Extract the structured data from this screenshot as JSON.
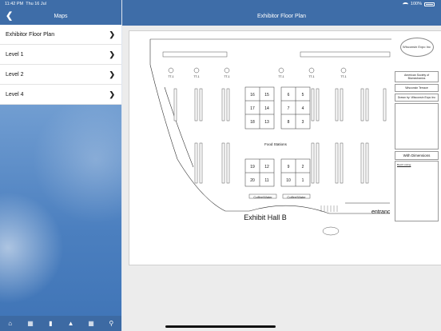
{
  "status_bar": {
    "time": "11:42 PM",
    "date": "Thu 16 Jul",
    "battery": "100%"
  },
  "sidebar": {
    "title": "Maps",
    "items": [
      {
        "label": "Exhibitor Floor Plan"
      },
      {
        "label": "Level 1"
      },
      {
        "label": "Level 2"
      },
      {
        "label": "Level 4"
      }
    ],
    "toolbar_icons": [
      "home-icon",
      "exhibitors-icon",
      "document-icon",
      "sitemap-icon",
      "grid-icon",
      "search-icon"
    ]
  },
  "main": {
    "title": "Exhibitor Floor Plan",
    "floorplan": {
      "hall_label": "Exhibit Hall B",
      "entrance_label": "entranc",
      "food_label": "Food Stations",
      "coffee_labels": [
        "Coffee/Water",
        "Coffee/Water"
      ],
      "tt_labels": [
        "TT-1",
        "TT-1",
        "TT-1",
        "TT-1",
        "TT-1",
        "TT-1"
      ],
      "booths_upper_left": [
        "16",
        "15",
        "17",
        "14",
        "18",
        "13"
      ],
      "booths_upper_right": [
        "6",
        "5",
        "7",
        "4",
        "8",
        "3"
      ],
      "booths_lower_left": [
        "19",
        "12",
        "20",
        "11"
      ],
      "booths_lower_right": [
        "9",
        "2",
        "10",
        "1"
      ],
      "legend": {
        "org": "American Society of Biomechanics",
        "venue": "Wisconsin Terrace",
        "drawn_by": "Drawn by: Wisconsin Expo Inc",
        "with_dimensions": "With Dimensions",
        "listing_title": "Booth Listing"
      },
      "logo_text": "Wisconsin Expo Inc"
    }
  },
  "colors": {
    "header": "#3e6da8",
    "toolbar": "#3d6aa3"
  }
}
